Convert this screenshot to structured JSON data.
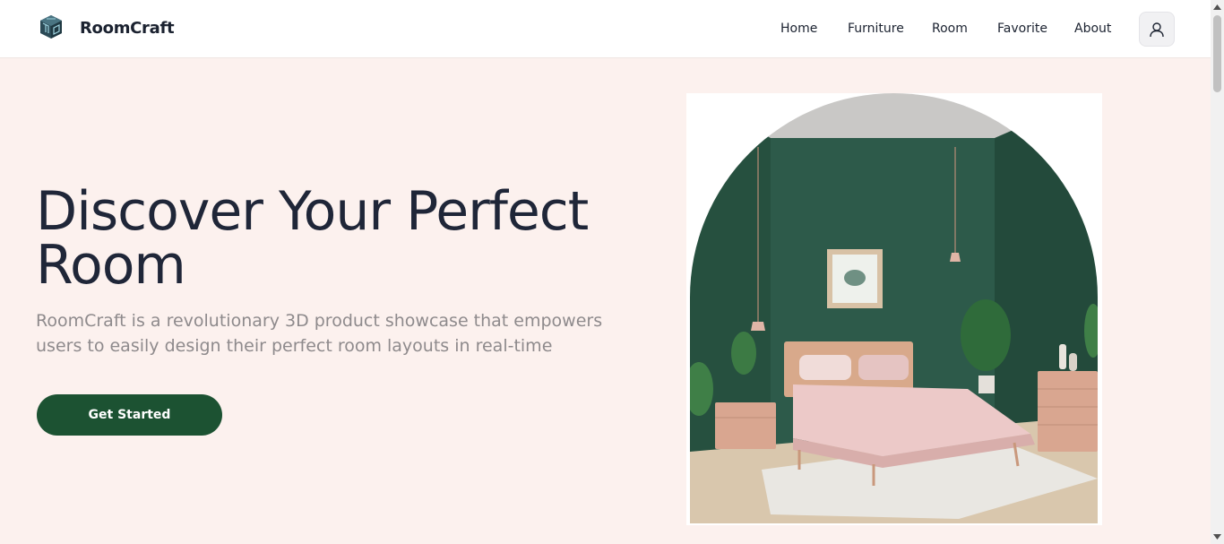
{
  "brand": {
    "name": "RoomCraft",
    "logo_icon": "cube-logo-icon"
  },
  "nav": {
    "items": [
      {
        "label": "Home"
      },
      {
        "label": "Furniture"
      },
      {
        "label": "Room"
      },
      {
        "label": "Favorite"
      },
      {
        "label": "About"
      }
    ],
    "user_icon": "user-icon"
  },
  "hero": {
    "title": "Discover Your Perfect Room",
    "subtitle": "RoomCraft is a revolutionary 3D product showcase that empowers users to easily design their perfect room layouts in real-time",
    "cta_label": "Get Started",
    "image_icon": "bedroom-illustration"
  },
  "colors": {
    "background": "#fcf1ee",
    "primary": "#1c5232",
    "heading": "#1f2638",
    "muted_text": "#8e8a8c",
    "wall_green": "#2c5a49"
  }
}
